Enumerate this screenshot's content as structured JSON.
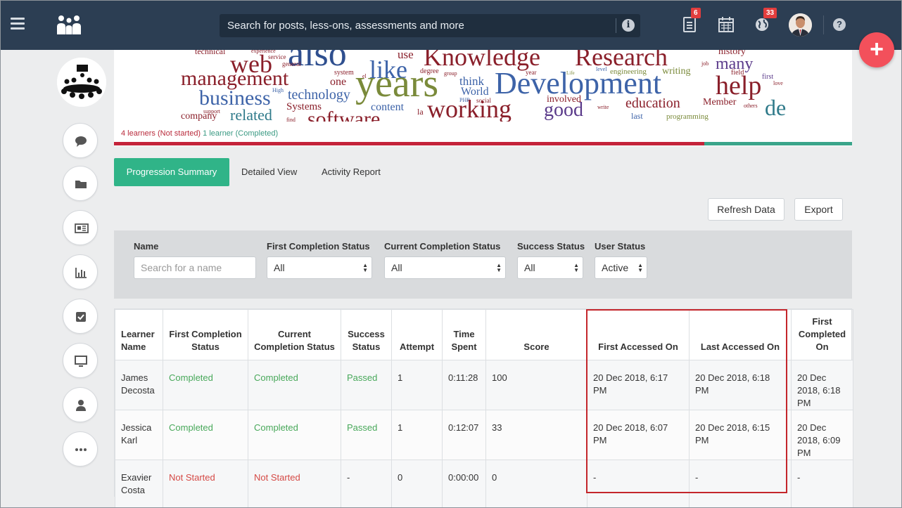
{
  "search": {
    "placeholder": "Search for posts, less-ons, assessments and more"
  },
  "nav": {
    "notes_badge": "6",
    "globe_badge": "33"
  },
  "banner": {
    "cloud_words": [
      "technical",
      "also",
      "use",
      "Knowledge",
      "Research",
      "history",
      "web",
      "like",
      "management",
      "many",
      "business",
      "technology",
      "one",
      "years",
      "think",
      "Development",
      "help",
      "World",
      "related",
      "Systems",
      "content",
      "working",
      "good",
      "education",
      "Member",
      "de",
      "company",
      "software",
      "involved",
      "last",
      "programming",
      "writing",
      "engineering",
      "service",
      "general",
      "system",
      "degree",
      "group",
      "level",
      "field",
      "first",
      "love",
      "job",
      "High",
      "support",
      "PHP",
      "social",
      "Life",
      "year",
      "others",
      "write",
      "la",
      "el",
      "find",
      "experience"
    ],
    "status_not_started": "4 learners (Not started)",
    "status_completed": "1 learner (Completed)",
    "progress_not_started": 0.8,
    "progress_completed": 0.2
  },
  "tabs": [
    "Progression Summary",
    "Detailed View",
    "Activity Report"
  ],
  "actions": {
    "refresh": "Refresh Data",
    "export": "Export"
  },
  "filters": {
    "name_label": "Name",
    "name_placeholder": "Search for a name",
    "first_completion_label": "First Completion Status",
    "first_completion_value": "All",
    "current_completion_label": "Current Completion Status",
    "current_completion_value": "All",
    "success_label": "Success Status",
    "success_value": "All",
    "user_status_label": "User Status",
    "user_status_value": "Active"
  },
  "table": {
    "headers": [
      "Learner Name",
      "First Completion Status",
      "Current Completion Status",
      "Success Status",
      "Attempt",
      "Time Spent",
      "Score",
      "First Accessed On",
      "Last Accessed On",
      "First Completed On"
    ],
    "rows": [
      {
        "name": "James Decosta",
        "first_completion": "Completed",
        "current_completion": "Completed",
        "success": "Passed",
        "attempt": "1",
        "time_spent": "0:11:28",
        "score": "100",
        "first_accessed": "20 Dec 2018, 6:17 PM",
        "last_accessed": "20 Dec 2018, 6:18 PM",
        "first_completed": "20 Dec 2018, 6:18 PM"
      },
      {
        "name": "Jessica Karl",
        "first_completion": "Completed",
        "current_completion": "Completed",
        "success": "Passed",
        "attempt": "1",
        "time_spent": "0:12:07",
        "score": "33",
        "first_accessed": "20 Dec 2018, 6:07 PM",
        "last_accessed": "20 Dec 2018, 6:15 PM",
        "first_completed": "20 Dec 2018, 6:09 PM"
      },
      {
        "name": "Exavier Costa",
        "first_completion": "Not Started",
        "current_completion": "Not Started",
        "success": "-",
        "attempt": "0",
        "time_spent": "0:00:00",
        "score": "0",
        "first_accessed": "-",
        "last_accessed": "-",
        "first_completed": "-"
      }
    ]
  },
  "colors": {
    "nav_bg": "#2c3e53",
    "accent_green": "#30b488",
    "status_red": "#b92b3c",
    "status_green": "#3a9a83",
    "fab_red": "#f3505b",
    "highlight_red": "#c4262b"
  }
}
